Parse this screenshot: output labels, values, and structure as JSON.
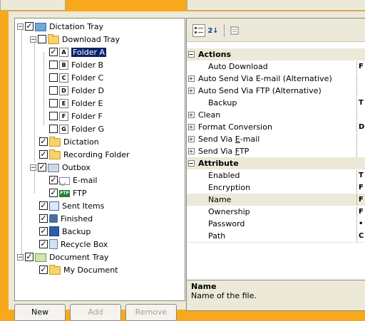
{
  "tree": {
    "items": [
      {
        "label": "Dictation Tray",
        "expander": "−",
        "checked": true,
        "icon": "dictation-tray-icon"
      },
      {
        "label": "Download Tray",
        "expander": "−",
        "checked": false,
        "icon": "download-tray-folder-icon"
      },
      {
        "label": "Folder A",
        "checked": true,
        "icon": "folder-a-icon",
        "letter": "A",
        "selected": true
      },
      {
        "label": "Folder B",
        "checked": false,
        "icon": "folder-b-icon",
        "letter": "B"
      },
      {
        "label": "Folder C",
        "checked": false,
        "icon": "folder-c-icon",
        "letter": "C"
      },
      {
        "label": "Folder D",
        "checked": false,
        "icon": "folder-d-icon",
        "letter": "D"
      },
      {
        "label": "Folder E",
        "checked": false,
        "icon": "folder-e-icon",
        "letter": "E"
      },
      {
        "label": "Folder F",
        "checked": false,
        "icon": "folder-f-icon",
        "letter": "F"
      },
      {
        "label": "Folder G",
        "checked": false,
        "icon": "folder-g-icon",
        "letter": "G"
      },
      {
        "label": "Dictation",
        "checked": true,
        "icon": "folder-icon"
      },
      {
        "label": "Recording Folder",
        "checked": true,
        "icon": "folder-icon"
      },
      {
        "label": "Outbox",
        "expander": "−",
        "checked": true,
        "icon": "outbox-icon"
      },
      {
        "label": "E-mail",
        "checked": true,
        "icon": "email-icon"
      },
      {
        "label": "FTP",
        "checked": true,
        "icon": "ftp-icon",
        "badge": "FTP"
      },
      {
        "label": "Sent Items",
        "checked": true,
        "icon": "sent-items-icon"
      },
      {
        "label": "Finished",
        "checked": true,
        "icon": "finished-icon"
      },
      {
        "label": "Backup",
        "checked": true,
        "icon": "backup-icon"
      },
      {
        "label": "Recycle Box",
        "checked": true,
        "icon": "recycle-box-icon"
      },
      {
        "label": "Document Tray",
        "expander": "−",
        "checked": true,
        "icon": "document-tray-icon"
      },
      {
        "label": "My Document",
        "checked": true,
        "icon": "folder-icon"
      }
    ]
  },
  "toolbar": {
    "categorized_icon": "categorized-icon",
    "alphabetical_icon": "alphabetical-sort-icon",
    "alphabetical_glyph": "2↓",
    "pages_icon": "property-pages-icon"
  },
  "grid": {
    "rows": [
      {
        "type": "cat",
        "expander": "−",
        "label": "Actions"
      },
      {
        "type": "prop",
        "label": "Auto Download",
        "value": "F"
      },
      {
        "type": "prop",
        "expander": "+",
        "label": "Auto Send Via E-mail (Alternative)",
        "value": ""
      },
      {
        "type": "prop",
        "expander": "+",
        "label": "Auto Send Via FTP (Alternative)",
        "value": ""
      },
      {
        "type": "prop",
        "label": "Backup",
        "value": "T"
      },
      {
        "type": "prop",
        "expander": "+",
        "label": "Clean",
        "value": ""
      },
      {
        "type": "prop",
        "expander": "+",
        "label": "Format Conversion",
        "value": "D"
      },
      {
        "type": "prop",
        "expander": "+",
        "label": "Send Via E-mail",
        "value": ""
      },
      {
        "type": "prop",
        "expander": "+",
        "label": "Send Via FTP",
        "value": ""
      },
      {
        "type": "cat",
        "expander": "−",
        "label": "Attribute"
      },
      {
        "type": "prop",
        "label": "Enabled",
        "value": "T"
      },
      {
        "type": "prop",
        "label": "Encryption",
        "value": "F"
      },
      {
        "type": "prop",
        "label": "Name",
        "value": "F",
        "selected": true
      },
      {
        "type": "prop",
        "label": "Ownership",
        "value": "F"
      },
      {
        "type": "prop",
        "label": "Password",
        "value": "•"
      },
      {
        "type": "prop",
        "label": "Path",
        "value": "C"
      }
    ]
  },
  "description": {
    "title": "Name",
    "text": "Name of the file."
  },
  "buttons": {
    "new": "New",
    "add": "Add",
    "remove": "Remove"
  },
  "colors": {
    "background": "#f7a81b",
    "selection": "#0a246a",
    "panel": "#ece9d8"
  }
}
